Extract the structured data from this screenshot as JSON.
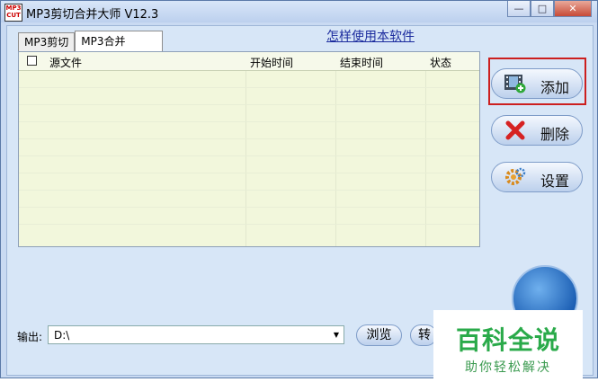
{
  "window": {
    "title": "MP3剪切合并大师 V12.3",
    "app_icon_text": "MP3 CUT",
    "buttons": {
      "minimize": "—",
      "maximize": "□",
      "close": "✕"
    }
  },
  "tabs": [
    {
      "label": "MP3剪切",
      "active": false
    },
    {
      "label": "MP3合并",
      "active": true
    }
  ],
  "help_link": "怎样使用本软件",
  "table": {
    "columns": [
      "源文件",
      "开始时间",
      "结束时间",
      "状态"
    ],
    "rows": []
  },
  "side_buttons": {
    "add": {
      "label": "添加",
      "icon": "film-add-icon"
    },
    "delete": {
      "label": "删除",
      "icon": "red-x-icon"
    },
    "settings": {
      "label": "设置",
      "icon": "gear-icon"
    }
  },
  "output": {
    "label": "输出:",
    "path": "D:\\",
    "browse_label": "浏览",
    "convert_label": "转"
  },
  "watermark": {
    "top": "百科全说",
    "bottom": "助你轻松解决"
  },
  "colors": {
    "selection_frame": "#cc1f1f",
    "link": "#1c2c9e",
    "watermark_green": "#2aaa4a"
  }
}
